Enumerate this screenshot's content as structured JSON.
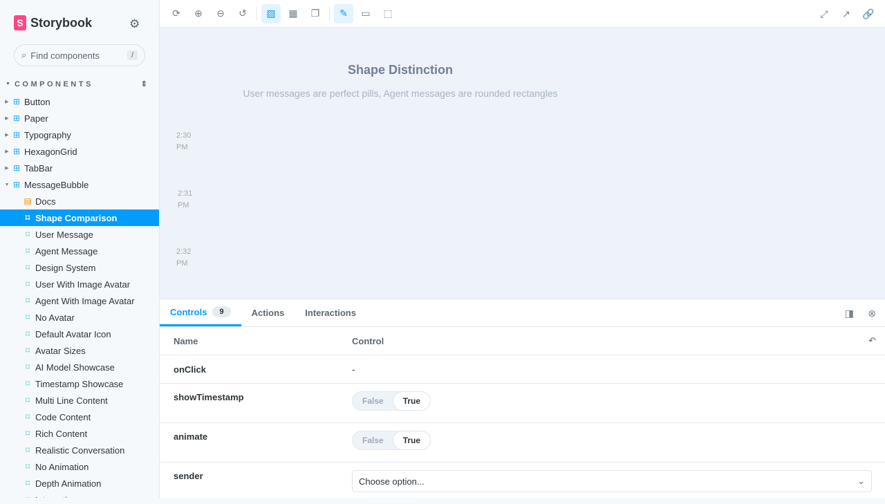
{
  "sidebar": {
    "brand": "Storybook",
    "search_placeholder": "Find components",
    "search_shortcut": "/",
    "section": "COMPONENTS",
    "components": [
      "Button",
      "Paper",
      "Typography",
      "HexagonGrid",
      "TabBar",
      "MessageBubble"
    ],
    "docs": "Docs",
    "stories": [
      "Shape Comparison",
      "User Message",
      "Agent Message",
      "Design System",
      "User With Image Avatar",
      "Agent With Image Avatar",
      "No Avatar",
      "Default Avatar Icon",
      "Avatar Sizes",
      "AI Model Showcase",
      "Timestamp Showcase",
      "Multi Line Content",
      "Code Content",
      "Rich Content",
      "Realistic Conversation",
      "No Animation",
      "Depth Animation",
      "Interactive"
    ],
    "selected": "Shape Comparison"
  },
  "canvas": {
    "title": "Shape Distinction",
    "subtitle": "User messages are perfect pills, Agent messages are rounded rectangles",
    "timestamps": [
      [
        "2:30",
        "PM"
      ],
      [
        "2:31",
        "PM"
      ],
      [
        "2:32",
        "PM"
      ]
    ]
  },
  "panel": {
    "tabs": [
      "Controls",
      "Actions",
      "Interactions"
    ],
    "controls_count": "9",
    "col_name": "Name",
    "col_control": "Control",
    "rows": {
      "onClick": {
        "name": "onClick",
        "value": "-"
      },
      "showTimestamp": {
        "name": "showTimestamp",
        "false": "False",
        "true": "True",
        "value": true
      },
      "animate": {
        "name": "animate",
        "false": "False",
        "true": "True",
        "value": true
      },
      "sender": {
        "name": "sender",
        "placeholder": "Choose option..."
      }
    }
  },
  "colors": {
    "accent": "#029cfd",
    "brand": "#ff4785"
  }
}
